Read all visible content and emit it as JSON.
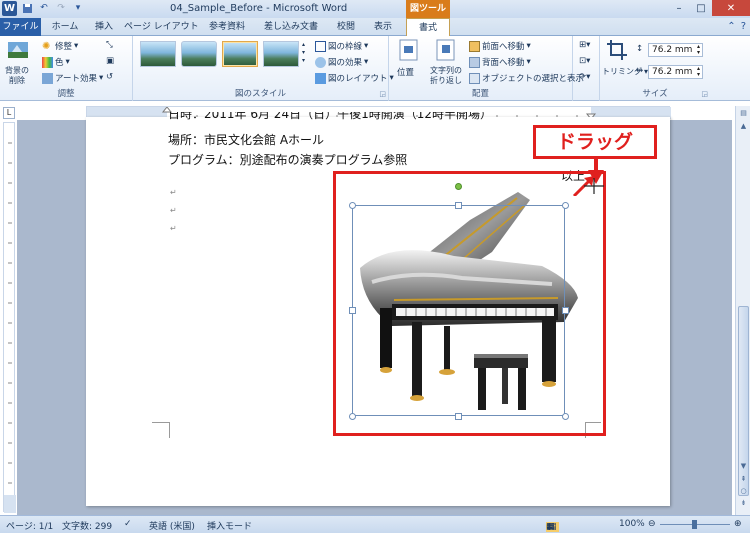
{
  "window": {
    "title": "04_Sample_Before - Microsoft Word",
    "context_tool": "図ツール"
  },
  "tabs": [
    "ファイル",
    "ホーム",
    "挿入",
    "ページ レイアウト",
    "参考資料",
    "差し込み文書",
    "校閲",
    "表示",
    "書式"
  ],
  "ribbon": {
    "adjust": {
      "label": "調整",
      "remove_bg": "背景の削除",
      "corrections": "修整",
      "color": "色",
      "artistic": "アート効果"
    },
    "styles": {
      "label": "図のスタイル"
    },
    "picture_cmds": {
      "border": "図の枠線",
      "effects": "図の効果",
      "layout": "図のレイアウト"
    },
    "arrange": {
      "label": "配置",
      "position": "位置",
      "wrap": "文字列の折り返し",
      "forward": "前面へ移動",
      "backward": "背面へ移動",
      "selection": "オブジェクトの選択と表示"
    },
    "size": {
      "label": "サイズ",
      "crop": "トリミング",
      "height": "76.2 mm",
      "width": "76.2 mm"
    }
  },
  "document": {
    "line1": "日時：2011年 6月 24日（日）午後1時開演（12時半開場）",
    "line2": "場所：市民文化会館 Aホール",
    "line3": "プログラム：別途配布の演奏プログラム参照",
    "ijou": "以上",
    "para_mark": "↵"
  },
  "annotation": {
    "drag_label": "ドラッグ"
  },
  "status": {
    "page": "ページ: 1/1",
    "words": "文字数: 299",
    "lang": "英語 (米国)",
    "mode": "挿入モード",
    "zoom": "100%"
  },
  "colors": {
    "accent_red": "#e0201e",
    "ribbon_blue": "#2a5fa8"
  }
}
